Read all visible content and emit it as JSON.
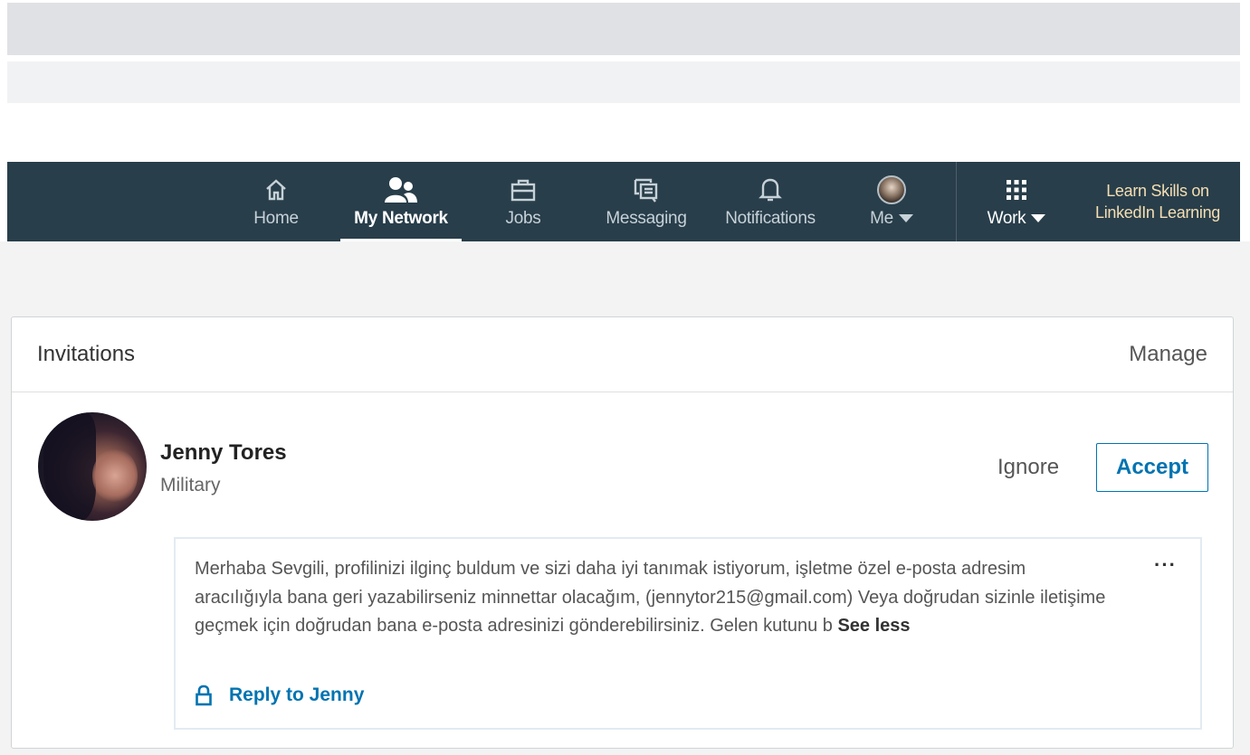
{
  "nav": {
    "items": [
      {
        "label": "Home",
        "icon": "home-icon"
      },
      {
        "label": "My Network",
        "icon": "network-icon",
        "active": true
      },
      {
        "label": "Jobs",
        "icon": "briefcase-icon"
      },
      {
        "label": "Messaging",
        "icon": "messaging-icon"
      },
      {
        "label": "Notifications",
        "icon": "bell-icon"
      }
    ],
    "me_label": "Me",
    "work_label": "Work",
    "learning_line1": "Learn Skills on",
    "learning_line2": "LinkedIn Learning"
  },
  "invitations": {
    "title": "Invitations",
    "manage_label": "Manage",
    "invite": {
      "name": "Jenny Tores",
      "headline": "Military",
      "ignore_label": "Ignore",
      "accept_label": "Accept",
      "message": "Merhaba Sevgili, profilinizi ilginç buldum ve sizi daha iyi tanımak istiyorum, işletme özel e-posta adresim aracılığıyla bana geri yazabilirseniz minnettar olacağım, (jennytor215@gmail.com) Veya doğrudan sizinle iletişime geçmek için doğrudan bana e-posta adresinizi gönderebilirsiniz. Gelen kutunu b",
      "see_less_label": "See less",
      "more_label": "···",
      "reply_label": "Reply to Jenny"
    }
  },
  "colors": {
    "nav_bg": "#283e4a",
    "accent": "#0073b1",
    "learning_text": "#f5deb3"
  }
}
